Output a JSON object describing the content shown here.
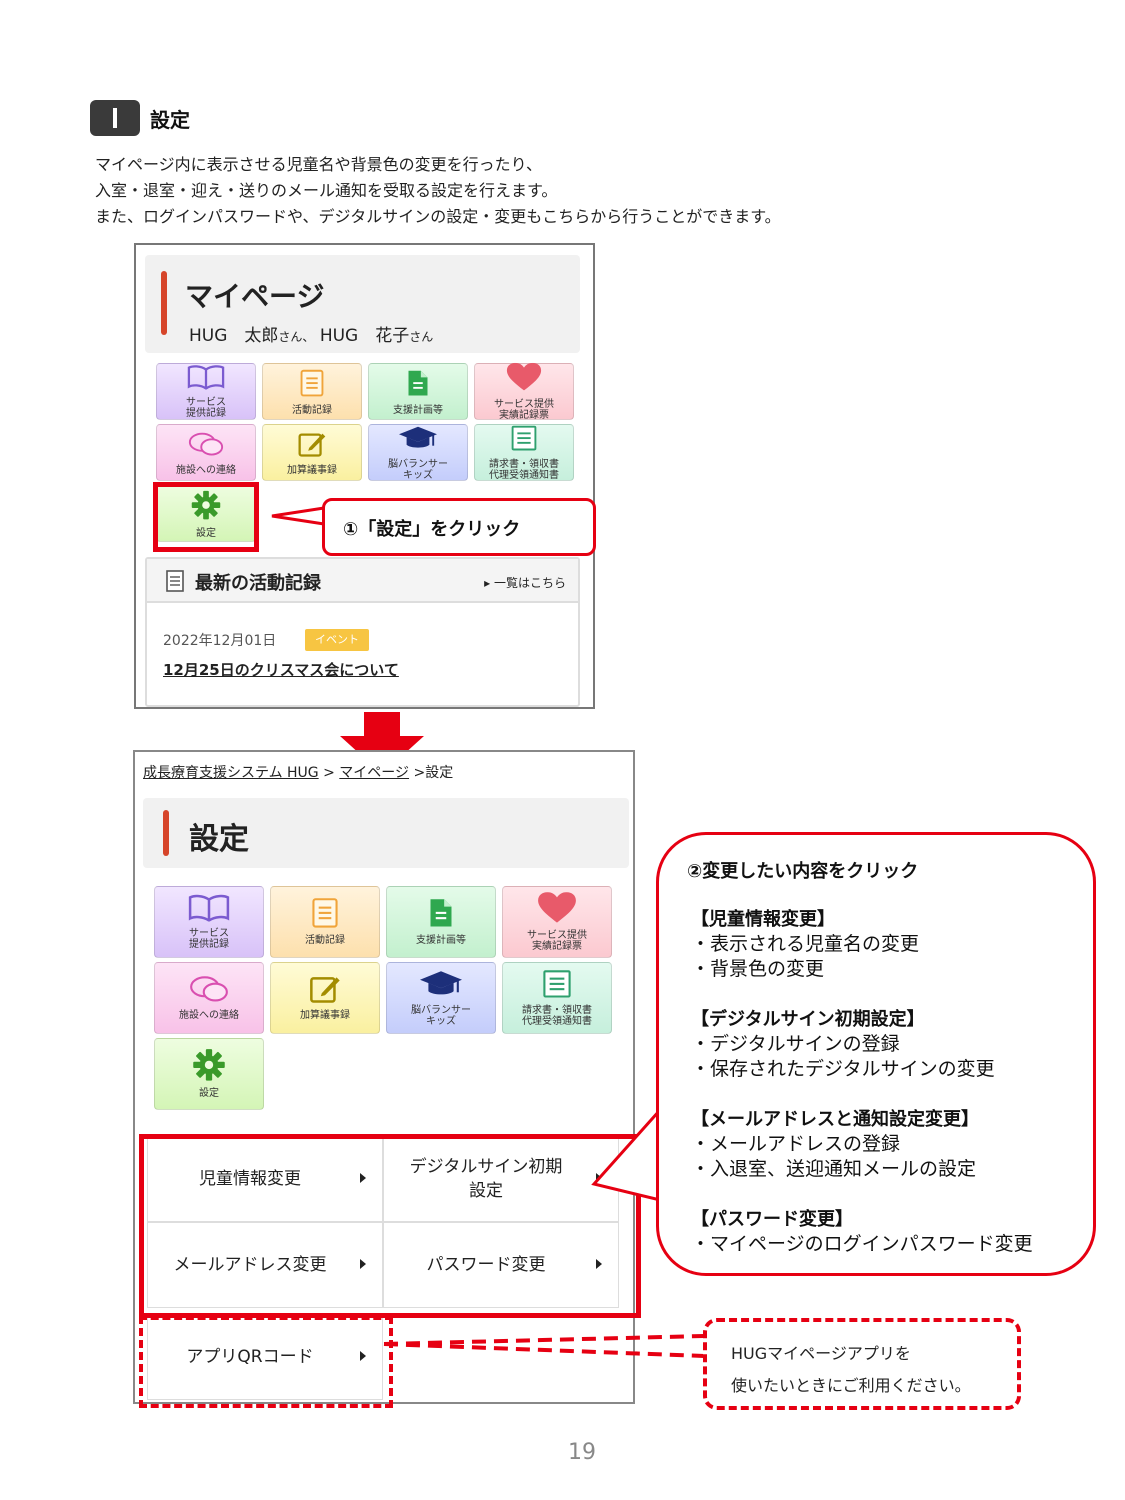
{
  "section": {
    "number": "I",
    "title": "設定"
  },
  "intro_lines": [
    "マイページ内に表示させる児童名や背景色の変更を行ったり、",
    "入室・退室・迎え・送りのメール通知を受取る設定を行えます。",
    "また、ログインパスワードや、デジタルサインの設定・変更もこちらから行うことができます。"
  ],
  "mypage": {
    "title": "マイページ",
    "child1": "HUG　太郎",
    "suffix1": "さん、",
    "child2": "HUG　花子",
    "suffix2": "さん"
  },
  "tiles": [
    {
      "label": "サービス\n提供記録",
      "icon": "book-icon",
      "color": "#d8c2f8"
    },
    {
      "label": "活動記録",
      "icon": "document-icon",
      "color": "#fde0ad"
    },
    {
      "label": "支援計画等",
      "icon": "file-icon",
      "color": "#c3f0ce"
    },
    {
      "label": "サービス提供\n実績記録票",
      "icon": "heart-icon",
      "color": "#fbc9d0"
    },
    {
      "label": "施設への連絡",
      "icon": "chat-icon",
      "color": "#f8c2e8"
    },
    {
      "label": "加算議事録",
      "icon": "edit-icon",
      "color": "#faf0a0"
    },
    {
      "label": "脳バランサー\nキッズ",
      "icon": "graduation-cap-icon",
      "color": "#c4cdfb"
    },
    {
      "label": "請求書・領収書\n代理受領通知書",
      "icon": "list-icon",
      "color": "#c6efdc"
    },
    {
      "label": "設定",
      "icon": "gear-icon",
      "color": "#d4f5b6"
    }
  ],
  "callout1": "①「設定」をクリック",
  "latest": {
    "title": "最新の活動記録",
    "more": "一覧はこちら",
    "date": "2022年12月01日",
    "badge": "イベント",
    "link": "12月25日のクリスマス会について"
  },
  "breadcrumb": {
    "root": "成長療育支援システム HUG",
    "sep": ">",
    "mid": "マイページ",
    "current": "設定"
  },
  "settings_title": "設定",
  "menu": [
    {
      "label": "児童情報変更"
    },
    {
      "label": "デジタルサイン初期\n設定"
    },
    {
      "label": "メールアドレス変更"
    },
    {
      "label": "パスワード変更"
    },
    {
      "label": "アプリQRコード"
    }
  ],
  "callout2": {
    "heading": "②変更したい内容をクリック",
    "sections": [
      {
        "head": "【児童情報変更】",
        "items": [
          "・表示される児童名の変更",
          "・背景色の変更"
        ]
      },
      {
        "head": "【デジタルサイン初期設定】",
        "items": [
          "・デジタルサインの登録",
          "・保存されたデジタルサインの変更"
        ]
      },
      {
        "head": "【メールアドレスと通知設定変更】",
        "items": [
          "・メールアドレスの登録",
          "・入退室、送迎通知メールの設定"
        ]
      },
      {
        "head": "【パスワード変更】",
        "items": [
          "・マイページのログインパスワード変更"
        ]
      }
    ]
  },
  "note": {
    "line1": "HUGマイページアプリを",
    "line2": "使いたいときにご利用ください。"
  },
  "page_number": "19",
  "colors": {
    "highlight_red": "#e60012",
    "accent_bar": "#d6452a",
    "badge_yellow": "#f7c542"
  }
}
